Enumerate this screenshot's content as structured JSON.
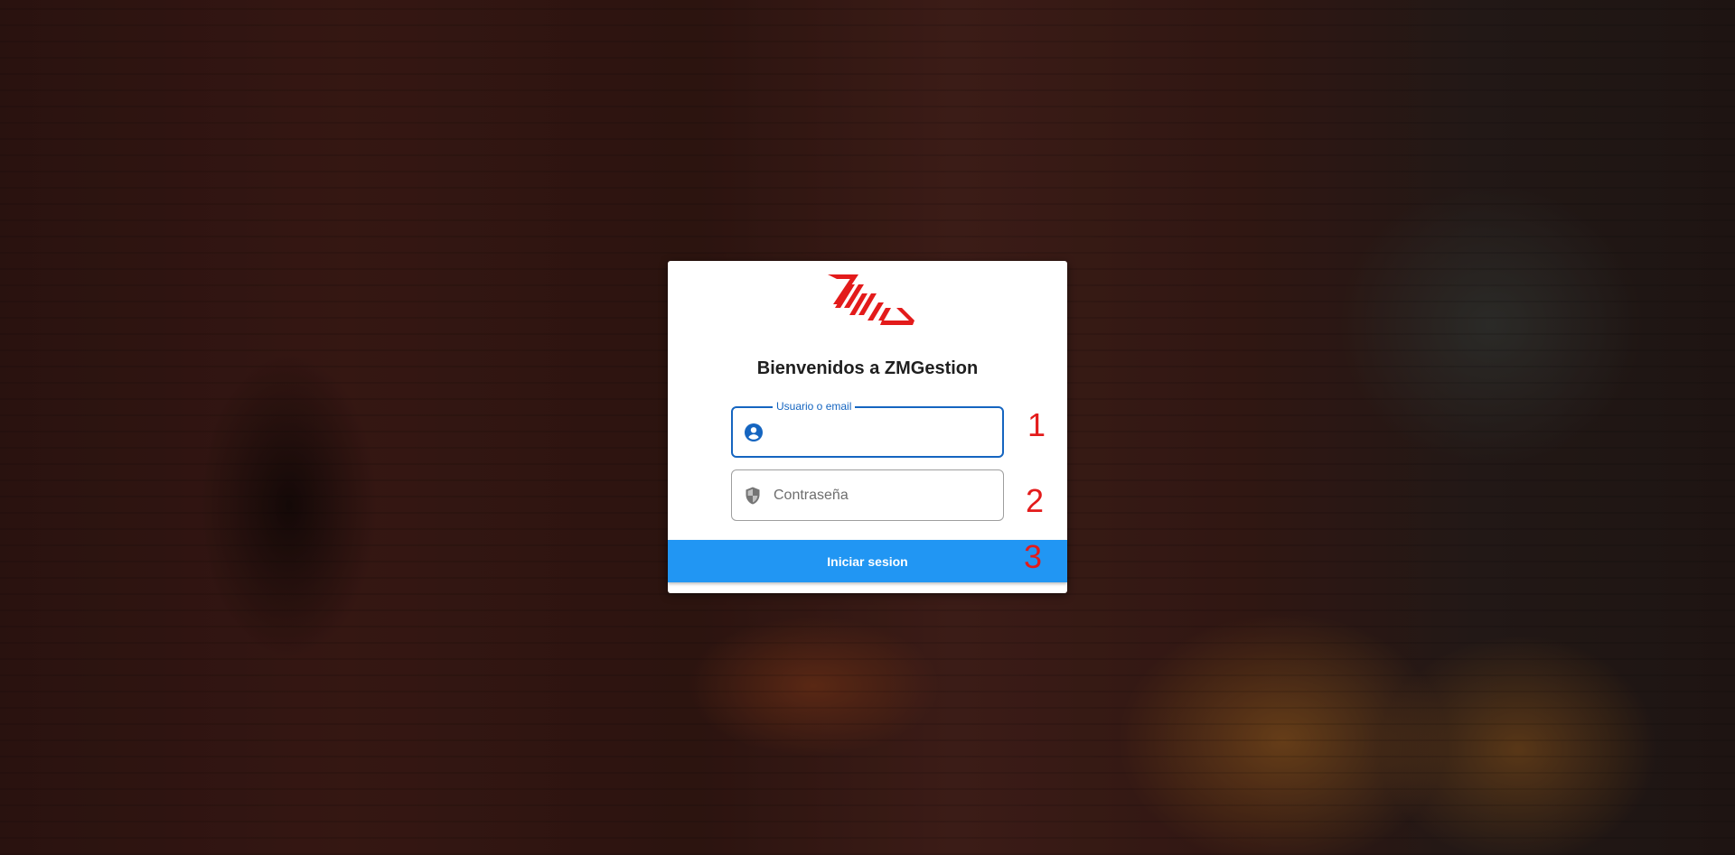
{
  "brand": {
    "logo": "zm-logo",
    "accent_color": "#e31b1b"
  },
  "login": {
    "title": "Bienvenidos a ZMGestion",
    "username": {
      "label": "Usuario o email",
      "value": "",
      "icon": "account-circle-icon"
    },
    "password": {
      "placeholder": "Contraseña",
      "value": "",
      "icon": "shield-icon"
    },
    "submit_label": "Iniciar sesion",
    "submit_color": "#2196f3",
    "focus_color": "#1565c0"
  },
  "annotations": [
    "1",
    "2",
    "3"
  ]
}
